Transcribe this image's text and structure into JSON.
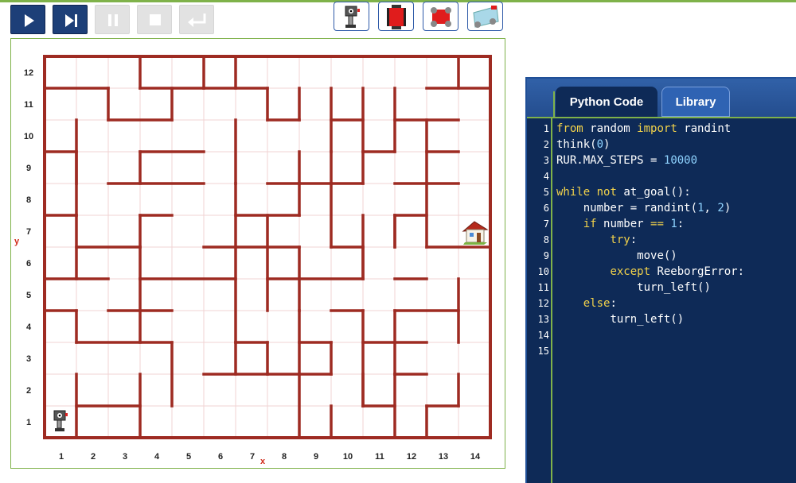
{
  "toolbar": {
    "buttons": [
      {
        "name": "run-button",
        "icon": "play-icon",
        "state": "active"
      },
      {
        "name": "step-button",
        "icon": "step-icon",
        "state": "active"
      },
      {
        "name": "pause-button",
        "icon": "pause-icon",
        "state": "disabled"
      },
      {
        "name": "stop-button",
        "icon": "stop-icon",
        "state": "disabled"
      },
      {
        "name": "reload-button",
        "icon": "return-icon",
        "state": "disabled"
      }
    ],
    "robot_buttons": [
      {
        "name": "classic-robot-button",
        "icon": "classic-robot-icon"
      },
      {
        "name": "square-robot-button",
        "icon": "square-robot-icon"
      },
      {
        "name": "red-car-robot-button",
        "icon": "red-car-robot-icon"
      },
      {
        "name": "blue-car-robot-button",
        "icon": "blue-car-robot-icon"
      }
    ]
  },
  "world": {
    "columns": 14,
    "rows": 12,
    "x_ticks": [
      "1",
      "2",
      "3",
      "4",
      "5",
      "6",
      "7",
      "8",
      "9",
      "10",
      "11",
      "12",
      "13",
      "14"
    ],
    "y_ticks": [
      "1",
      "2",
      "3",
      "4",
      "5",
      "6",
      "7",
      "8",
      "9",
      "10",
      "11",
      "12"
    ],
    "x_axis_label": "x",
    "y_axis_label": "y",
    "robot": {
      "x": 1,
      "y": 1,
      "icon": "robot-icon"
    },
    "goal": {
      "x": 14,
      "y": 7,
      "icon": "house-icon"
    },
    "colors": {
      "wall": "#9e2b22",
      "grid": "#f1d3d3",
      "axis_label": "#d12a1a"
    }
  },
  "editor": {
    "tabs": [
      {
        "label": "Python Code",
        "selected": true
      },
      {
        "label": "Library",
        "selected": false
      }
    ],
    "line_numbers": [
      "1",
      "2",
      "3",
      "4",
      "5",
      "6",
      "7",
      "8",
      "9",
      "10",
      "11",
      "12",
      "13",
      "14",
      "15"
    ],
    "code_lines": [
      "from random import randint",
      "think(0)",
      "RUR.MAX_STEPS = 10000",
      "",
      "while not at_goal():",
      "    number = randint(1, 2)",
      "    if number == 1:",
      "        try:",
      "            move()",
      "        except ReeborgError:",
      "            turn_left()",
      "    else:",
      "        turn_left()",
      "",
      ""
    ]
  }
}
